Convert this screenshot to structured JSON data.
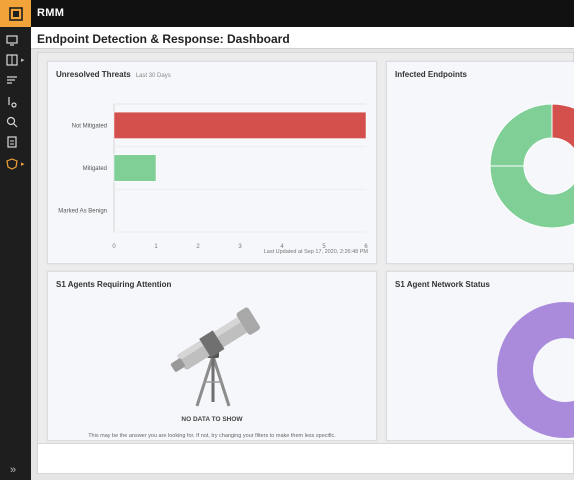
{
  "app": {
    "name": "RMM"
  },
  "page": {
    "title": "Endpoint Detection & Response: Dashboard"
  },
  "nav": {
    "items": [
      {
        "icon": "monitor-icon",
        "has_submenu": false
      },
      {
        "icon": "grid-icon",
        "has_submenu": true
      },
      {
        "icon": "list-icon",
        "has_submenu": false
      },
      {
        "icon": "network-icon",
        "has_submenu": false
      },
      {
        "icon": "search-icon",
        "has_submenu": false
      },
      {
        "icon": "report-icon",
        "has_submenu": false
      },
      {
        "icon": "shield-icon",
        "has_submenu": true,
        "active": true
      }
    ],
    "expand_glyph": "»"
  },
  "cards": {
    "threats": {
      "title": "Unresolved Threats",
      "subtitle": "Last 30 Days",
      "updated": "Last Updated at Sep 17, 2020, 2:26:48 PM"
    },
    "infected": {
      "title": "Infected Endpoints"
    },
    "agents": {
      "title": "S1 Agents Requiring Attention",
      "nodata_label": "NO DATA TO SHOW",
      "nodata_message": "This may be the answer you are looking for. If not, try changing your filters to make them less specific."
    },
    "network": {
      "title": "S1 Agent Network Status"
    }
  },
  "colors": {
    "red": "#d4504c",
    "green": "#7fcf97",
    "purple": "#a98adb",
    "accent": "#f2a33a"
  },
  "chart_data": [
    {
      "type": "bar",
      "orientation": "horizontal",
      "title": "Unresolved Threats",
      "subtitle": "Last 30 Days",
      "categories": [
        "Not Mitigated",
        "Mitigated",
        "Marked As Benign"
      ],
      "values": [
        6,
        1,
        0
      ],
      "bar_colors": [
        "#d4504c",
        "#7fcf97",
        "#7fcf97"
      ],
      "xlim": [
        0,
        6
      ],
      "xticks": [
        0,
        1,
        2,
        3,
        4,
        5,
        6
      ],
      "grid": true
    },
    {
      "type": "pie",
      "donut": true,
      "title": "Infected Endpoints",
      "slices": [
        {
          "value": 25,
          "color": "#d4504c"
        },
        {
          "value": 50,
          "color": "#7fcf97"
        },
        {
          "value": 25,
          "color": "#7fcf97"
        }
      ]
    },
    {
      "type": "pie",
      "donut": true,
      "title": "S1 Agent Network Status",
      "slices": [
        {
          "value": 100,
          "color": "#a98adb"
        }
      ]
    }
  ]
}
